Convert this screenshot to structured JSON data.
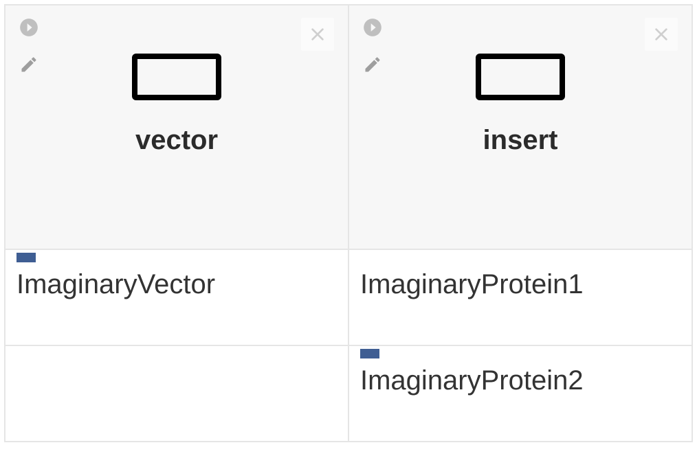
{
  "columns": [
    {
      "title": "vector"
    },
    {
      "title": "insert"
    }
  ],
  "rows": [
    {
      "cells": [
        {
          "text": "ImaginaryVector",
          "selected": true
        },
        {
          "text": "ImaginaryProtein1",
          "selected": false
        }
      ]
    },
    {
      "cells": [
        {
          "text": "",
          "selected": false
        },
        {
          "text": "ImaginaryProtein2",
          "selected": true
        }
      ]
    }
  ]
}
